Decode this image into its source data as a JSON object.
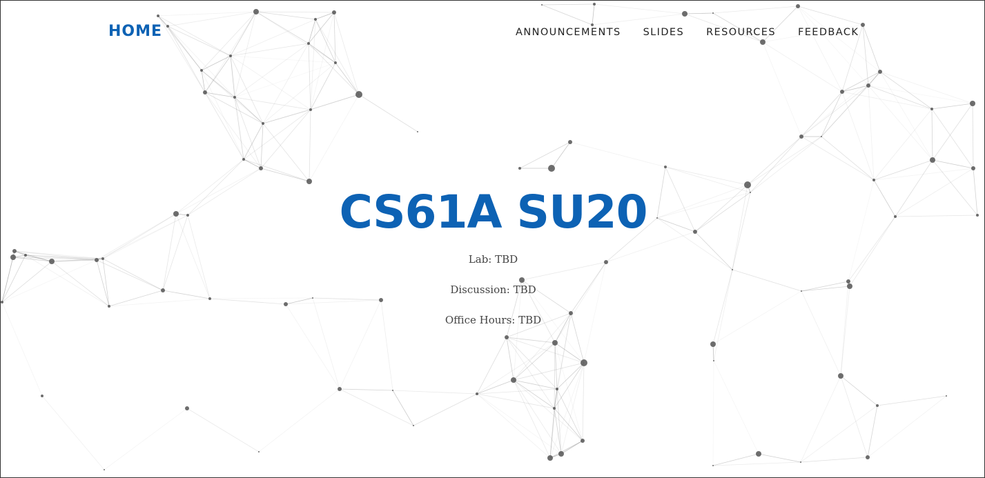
{
  "nav": {
    "home_label": "HOME",
    "links": [
      {
        "label": "ANNOUNCEMENTS"
      },
      {
        "label": "SLIDES"
      },
      {
        "label": "RESOURCES"
      },
      {
        "label": "FEEDBACK"
      }
    ]
  },
  "hero": {
    "title": "CS61A SU20",
    "lab": "Lab: TBD",
    "discussion": "Discussion: TBD",
    "office_hours": "Office Hours: TBD"
  },
  "theme": {
    "accent": "#0d62b4",
    "text": "#444444",
    "network_line": "#999999",
    "network_node": "#555555"
  }
}
